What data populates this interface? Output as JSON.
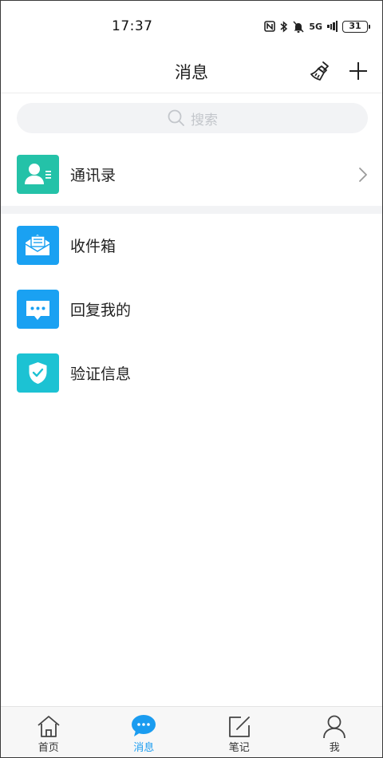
{
  "status_bar": {
    "time": "17:37",
    "network": "5G",
    "battery": "31",
    "icons": [
      "nfc-icon",
      "bluetooth-icon",
      "mute-icon",
      "signal-icon",
      "battery-icon"
    ]
  },
  "header": {
    "title": "消息",
    "icons": [
      "broom-icon",
      "plus-icon"
    ]
  },
  "search": {
    "placeholder": "搜索"
  },
  "contacts": {
    "label": "通讯录",
    "icon": "contacts-icon",
    "color": "#24c2a8"
  },
  "items": [
    {
      "label": "收件箱",
      "icon": "inbox-icon",
      "color": "#1aa1f2"
    },
    {
      "label": "回复我的",
      "icon": "reply-icon",
      "color": "#1aa1f2"
    },
    {
      "label": "验证信息",
      "icon": "verify-icon",
      "color": "#1cc2d3"
    }
  ],
  "tabbar": {
    "active": "消息",
    "active_color": "#1a9cf0",
    "tabs": [
      {
        "label": "首页",
        "icon": "home-icon"
      },
      {
        "label": "消息",
        "icon": "message-icon"
      },
      {
        "label": "笔记",
        "icon": "note-icon"
      },
      {
        "label": "我",
        "icon": "profile-icon"
      }
    ]
  }
}
